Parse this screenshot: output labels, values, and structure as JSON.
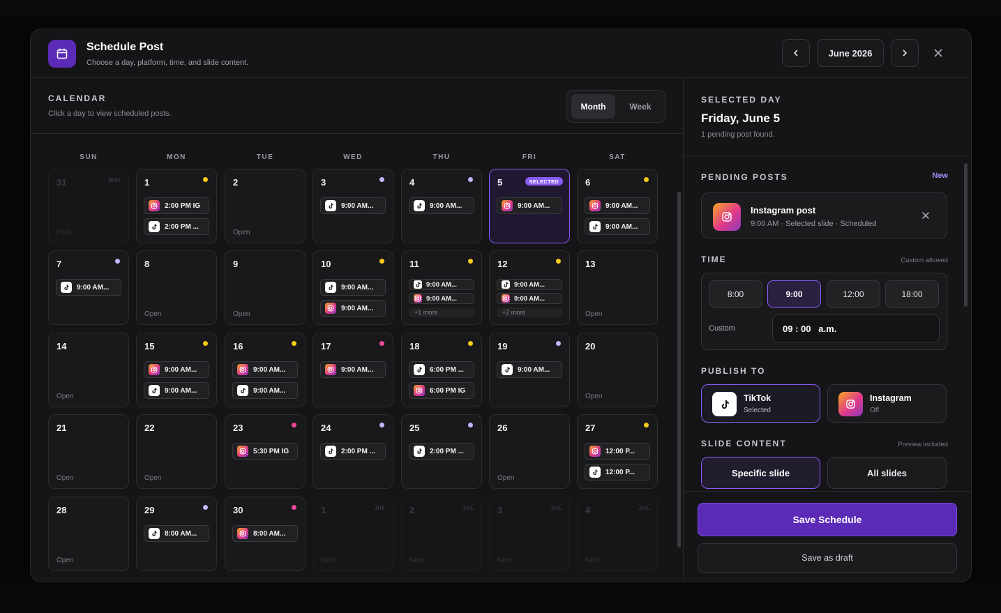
{
  "header": {
    "title": "Schedule Post",
    "subtitle": "Choose a day, platform, time, and slide content.",
    "month": "June 2026"
  },
  "calendar": {
    "heading": "CALENDAR",
    "subtitle": "Click a day to view scheduled posts.",
    "views": [
      "Month",
      "Week"
    ],
    "active_view": "Month",
    "weekdays": [
      "SUN",
      "MON",
      "TUE",
      "WED",
      "THU",
      "FRI",
      "SAT"
    ],
    "selected_badge": "SELECTED",
    "colors": {
      "accent": "#8b5cf6",
      "yellow": "#facc15",
      "purple": "#c4b5fd",
      "pink": "#ec4899"
    },
    "days": [
      {
        "n": "31",
        "tag": "MAY",
        "foot": "Past",
        "outside": true,
        "chips": []
      },
      {
        "n": "1",
        "dot": "yellow",
        "chips": [
          {
            "p": "ig",
            "t": "2:00 PM IG"
          },
          {
            "p": "tt",
            "t": "2:00 PM ..."
          }
        ]
      },
      {
        "n": "2",
        "foot": "Open",
        "chips": []
      },
      {
        "n": "3",
        "dot": "purple",
        "chips": [
          {
            "p": "tt",
            "t": "9:00 AM..."
          }
        ]
      },
      {
        "n": "4",
        "dot": "purple",
        "chips": [
          {
            "p": "tt",
            "t": "9:00 AM..."
          }
        ]
      },
      {
        "n": "5",
        "selected": true,
        "chips": [
          {
            "p": "ig",
            "t": "9:00 AM..."
          }
        ]
      },
      {
        "n": "6",
        "dot": "yellow",
        "chips": [
          {
            "p": "ig",
            "t": "9:00 AM..."
          },
          {
            "p": "tt",
            "t": "9:00 AM..."
          }
        ]
      },
      {
        "n": "7",
        "dot": "purple",
        "chips": [
          {
            "p": "tt",
            "t": "9:00 AM..."
          }
        ]
      },
      {
        "n": "8",
        "foot": "Open",
        "chips": []
      },
      {
        "n": "9",
        "foot": "Open",
        "chips": []
      },
      {
        "n": "10",
        "dot": "yellow",
        "chips": [
          {
            "p": "tt",
            "t": "9:00 AM..."
          },
          {
            "p": "ig",
            "t": "9:00 AM..."
          }
        ]
      },
      {
        "n": "11",
        "dot": "yellow",
        "compact": true,
        "more": "+1 more",
        "chips": [
          {
            "p": "tt",
            "t": "9:00 AM..."
          },
          {
            "p": "ig",
            "t": "9:00 AM..."
          }
        ]
      },
      {
        "n": "12",
        "dot": "yellow",
        "compact": true,
        "more": "+2 more",
        "chips": [
          {
            "p": "tt",
            "t": "9:00 AM..."
          },
          {
            "p": "ig",
            "t": "9:00 AM..."
          }
        ]
      },
      {
        "n": "13",
        "foot": "Open",
        "chips": []
      },
      {
        "n": "14",
        "foot": "Open",
        "chips": []
      },
      {
        "n": "15",
        "dot": "yellow",
        "chips": [
          {
            "p": "ig",
            "t": "9:00 AM..."
          },
          {
            "p": "tt",
            "t": "9:00 AM..."
          }
        ]
      },
      {
        "n": "16",
        "dot": "yellow",
        "chips": [
          {
            "p": "ig",
            "t": "9:00 AM..."
          },
          {
            "p": "tt",
            "t": "9:00 AM..."
          }
        ]
      },
      {
        "n": "17",
        "dot": "pink",
        "chips": [
          {
            "p": "ig",
            "t": "9:00 AM..."
          }
        ]
      },
      {
        "n": "18",
        "dot": "yellow",
        "chips": [
          {
            "p": "tt",
            "t": "6:00 PM ..."
          },
          {
            "p": "ig",
            "t": "6:00 PM IG"
          }
        ]
      },
      {
        "n": "19",
        "dot": "purple",
        "chips": [
          {
            "p": "tt",
            "t": "9:00 AM..."
          }
        ]
      },
      {
        "n": "20",
        "foot": "Open",
        "chips": []
      },
      {
        "n": "21",
        "foot": "Open",
        "chips": []
      },
      {
        "n": "22",
        "foot": "Open",
        "chips": []
      },
      {
        "n": "23",
        "dot": "pink",
        "chips": [
          {
            "p": "ig",
            "t": "5:30 PM IG"
          }
        ]
      },
      {
        "n": "24",
        "dot": "purple",
        "chips": [
          {
            "p": "tt",
            "t": "2:00 PM ..."
          }
        ]
      },
      {
        "n": "25",
        "dot": "purple",
        "chips": [
          {
            "p": "tt",
            "t": "2:00 PM ..."
          }
        ]
      },
      {
        "n": "26",
        "foot": "Open",
        "chips": []
      },
      {
        "n": "27",
        "dot": "yellow",
        "chips": [
          {
            "p": "ig",
            "t": "12:00 P..."
          },
          {
            "p": "tt",
            "t": "12:00 P..."
          }
        ]
      },
      {
        "n": "28",
        "foot": "Open",
        "chips": []
      },
      {
        "n": "29",
        "dot": "purple",
        "chips": [
          {
            "p": "tt",
            "t": "8:00 AM..."
          }
        ]
      },
      {
        "n": "30",
        "dot": "pink",
        "chips": [
          {
            "p": "ig",
            "t": "8:00 AM..."
          }
        ]
      },
      {
        "n": "1",
        "tag": "JUL",
        "foot": "Next",
        "outside": true,
        "chips": []
      },
      {
        "n": "2",
        "tag": "JUL",
        "foot": "Next",
        "outside": true,
        "chips": []
      },
      {
        "n": "3",
        "tag": "JUL",
        "foot": "Next",
        "outside": true,
        "chips": []
      },
      {
        "n": "4",
        "tag": "JUL",
        "foot": "Next",
        "outside": true,
        "chips": []
      }
    ]
  },
  "selected_day": {
    "heading": "SELECTED DAY",
    "title": "Friday, June 5",
    "subtitle": "1 pending post found."
  },
  "pending": {
    "heading": "PENDING POSTS",
    "new_label": "New",
    "post_title": "Instagram post",
    "post_meta": "9:00 AM · Selected slide · Scheduled"
  },
  "time": {
    "heading": "TIME",
    "hint": "Custom allowed",
    "presets": [
      "8:00",
      "9:00",
      "12:00",
      "18:00"
    ],
    "active_preset": "9:00",
    "custom_label": "Custom",
    "custom_value": "09 : 00   a.m."
  },
  "publish": {
    "heading": "PUBLISH TO",
    "tiktok_name": "TikTok",
    "tiktok_state": "Selected",
    "instagram_name": "Instagram",
    "instagram_state": "Off"
  },
  "slide": {
    "heading": "SLIDE CONTENT",
    "hint": "Preview included",
    "specific": "Specific slide",
    "all": "All slides"
  },
  "footer": {
    "save": "Save Schedule",
    "draft": "Save as draft"
  }
}
